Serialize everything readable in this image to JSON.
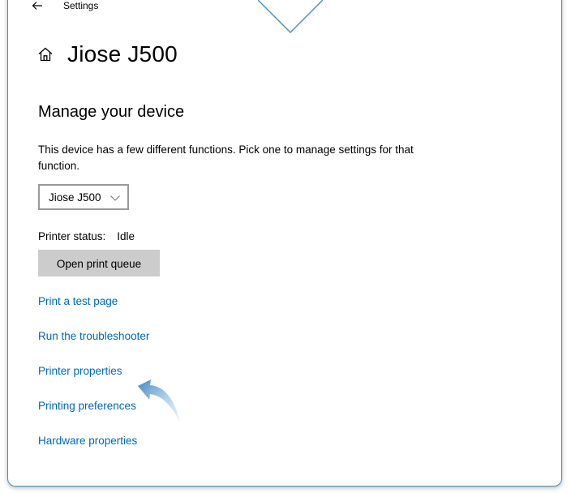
{
  "window": {
    "title": "Settings",
    "back_icon": "back-arrow-icon"
  },
  "header": {
    "icon": "home-icon",
    "title": "Jiose J500"
  },
  "section": {
    "title": "Manage your device",
    "description": "This device has a few different functions. Pick one to manage settings for that function."
  },
  "device_select": {
    "value": "Jiose J500",
    "icon": "chevron-down-icon"
  },
  "status": {
    "label": "Printer status:",
    "value": "Idle"
  },
  "queue_button": {
    "label": "Open print queue"
  },
  "links": [
    {
      "label": "Print a test page"
    },
    {
      "label": "Run the troubleshooter"
    },
    {
      "label": "Printer properties"
    },
    {
      "label": "Printing preferences"
    },
    {
      "label": "Hardware properties"
    }
  ],
  "annotation": {
    "icon": "curved-arrow-icon",
    "color": "#4a8fc7"
  },
  "colors": {
    "link": "#0067b8",
    "button_bg": "#cccccc",
    "window_border": "#4a90c2"
  }
}
